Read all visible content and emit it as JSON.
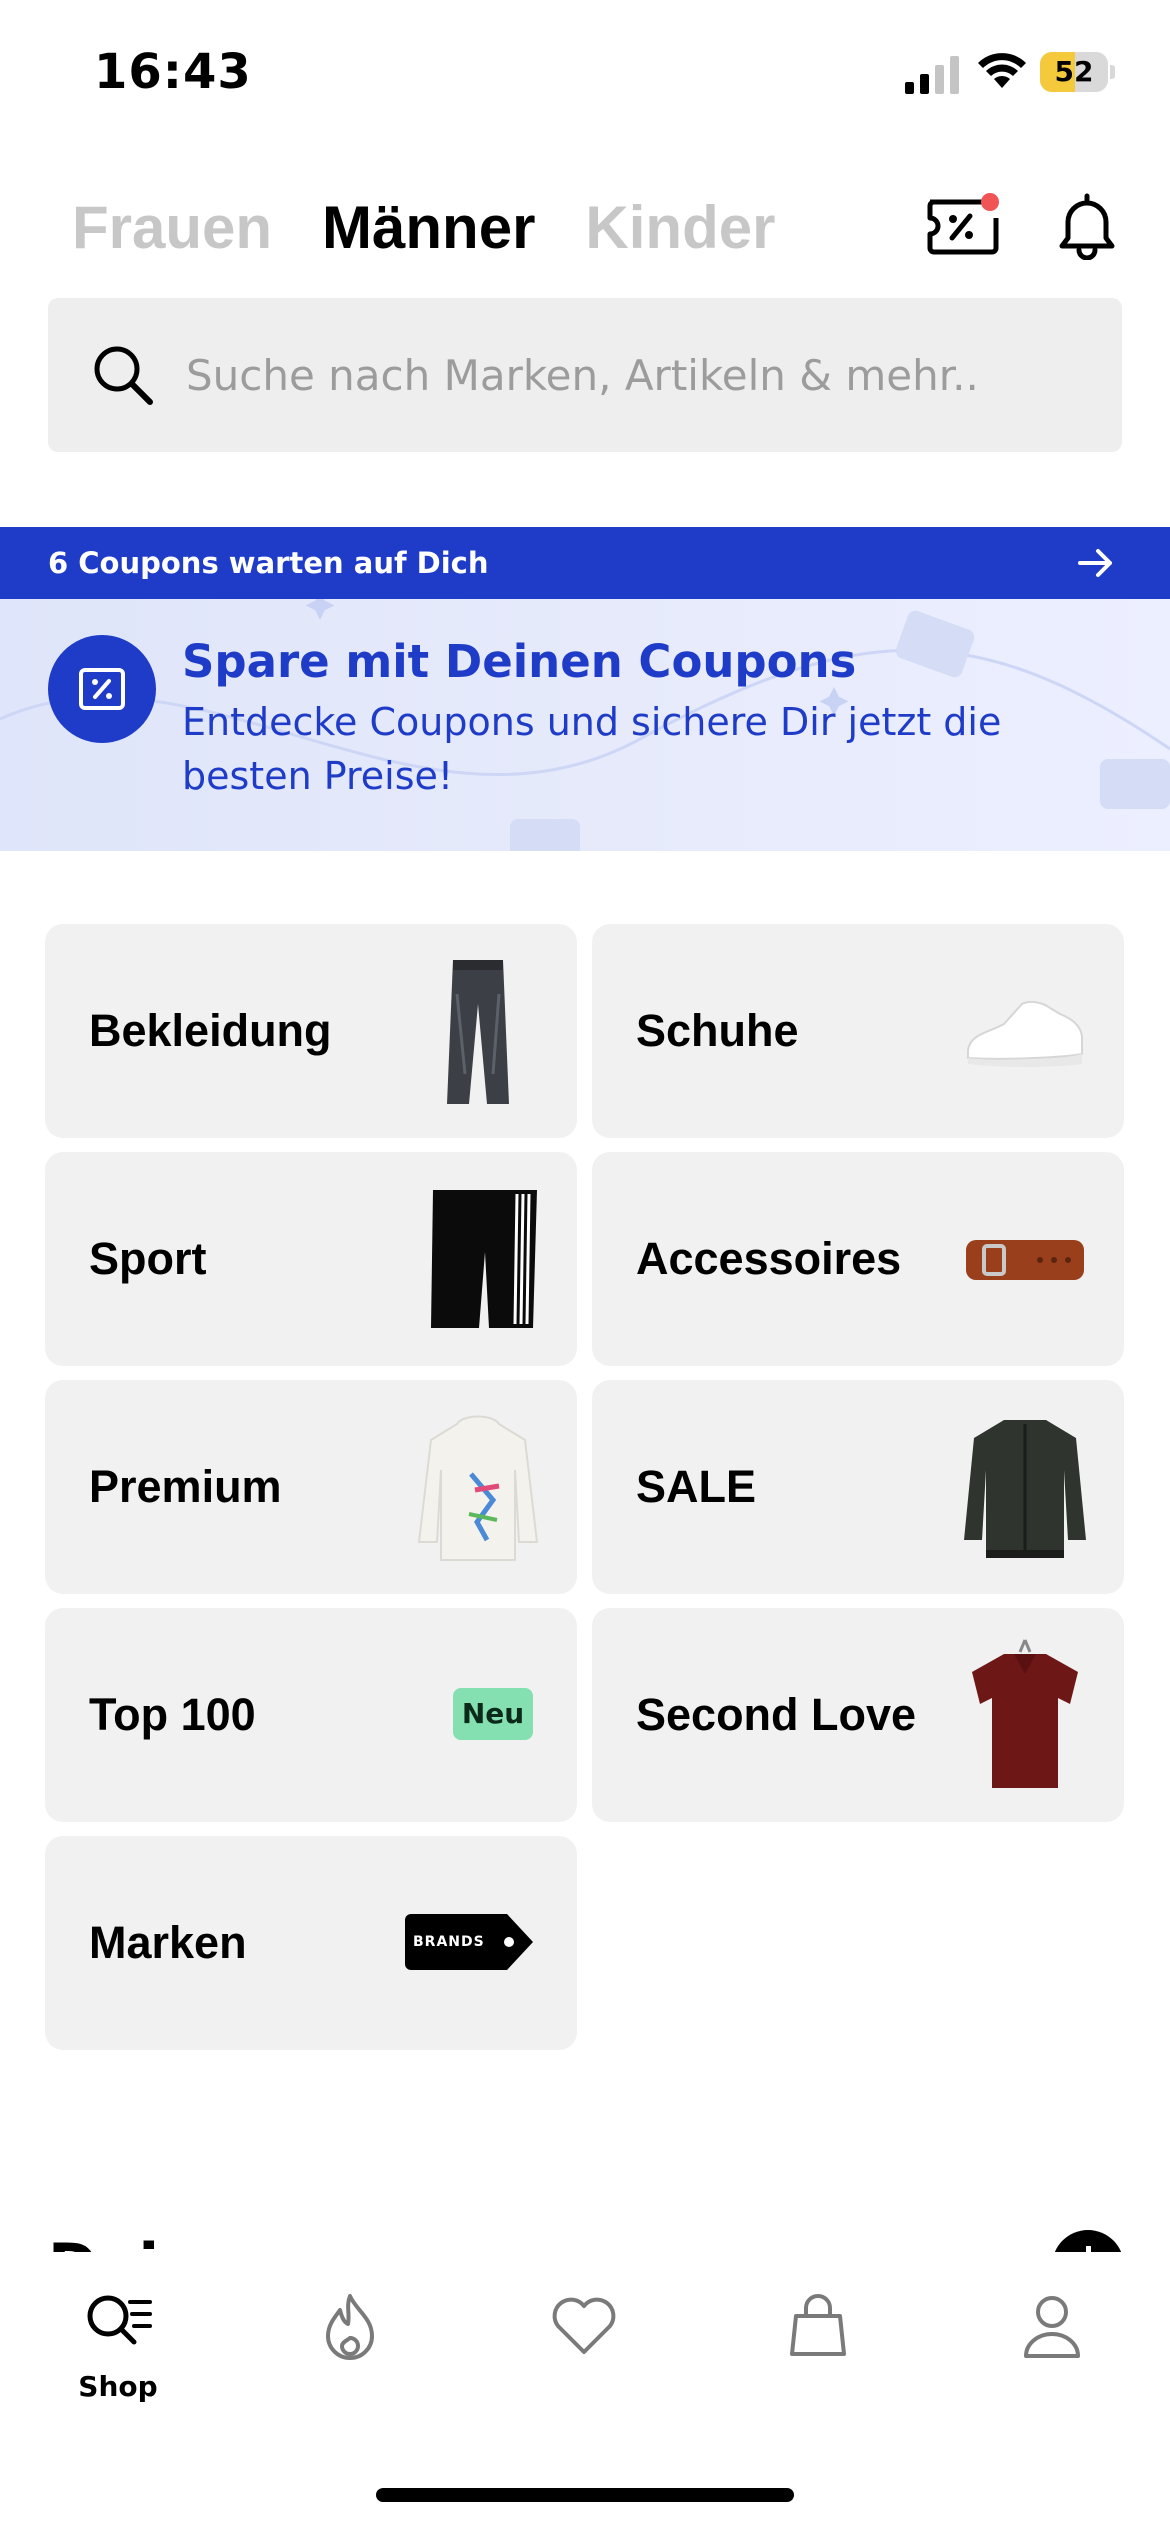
{
  "status_bar": {
    "time": "16:43",
    "battery_percent": "52",
    "battery_level": 0.52,
    "battery_color": "#f5c93c"
  },
  "header": {
    "tabs": [
      {
        "label": "Frauen",
        "active": false
      },
      {
        "label": "Männer",
        "active": true
      },
      {
        "label": "Kinder",
        "active": false
      }
    ],
    "icons": [
      "coupon-icon",
      "bell-icon"
    ],
    "notification_dot_color": "#f05454"
  },
  "search": {
    "placeholder": "Suche nach Marken, Artikeln & mehr..",
    "value": ""
  },
  "coupon_banner": {
    "strip_text": "6 Coupons warten auf Dich",
    "title": "Spare mit Deinen Coupons",
    "text": "Entdecke Coupons und sichere Dir jetzt die besten Preise!",
    "accent_color": "#1f3cc9"
  },
  "categories": [
    {
      "label": "Bekleidung",
      "icon": "jeans-image"
    },
    {
      "label": "Schuhe",
      "icon": "sneaker-image"
    },
    {
      "label": "Sport",
      "icon": "shorts-image"
    },
    {
      "label": "Accessoires",
      "icon": "belt-image"
    },
    {
      "label": "Premium",
      "icon": "hoodie-image"
    },
    {
      "label": "SALE",
      "icon": "jacket-image"
    },
    {
      "label": "Top 100",
      "badge": "Neu"
    },
    {
      "label": "Second Love",
      "icon": "polo-shirt-image"
    },
    {
      "label": "Marken",
      "tag": "BRANDS"
    }
  ],
  "next_section": {
    "title": "Deine Lieblingsmarken"
  },
  "bottom_nav": {
    "items": [
      {
        "label": "Shop",
        "icon": "shop-search-icon",
        "active": true
      },
      {
        "label": "",
        "icon": "flame-icon"
      },
      {
        "label": "",
        "icon": "heart-icon"
      },
      {
        "label": "",
        "icon": "shopping-bag-icon"
      },
      {
        "label": "",
        "icon": "profile-icon"
      }
    ]
  }
}
